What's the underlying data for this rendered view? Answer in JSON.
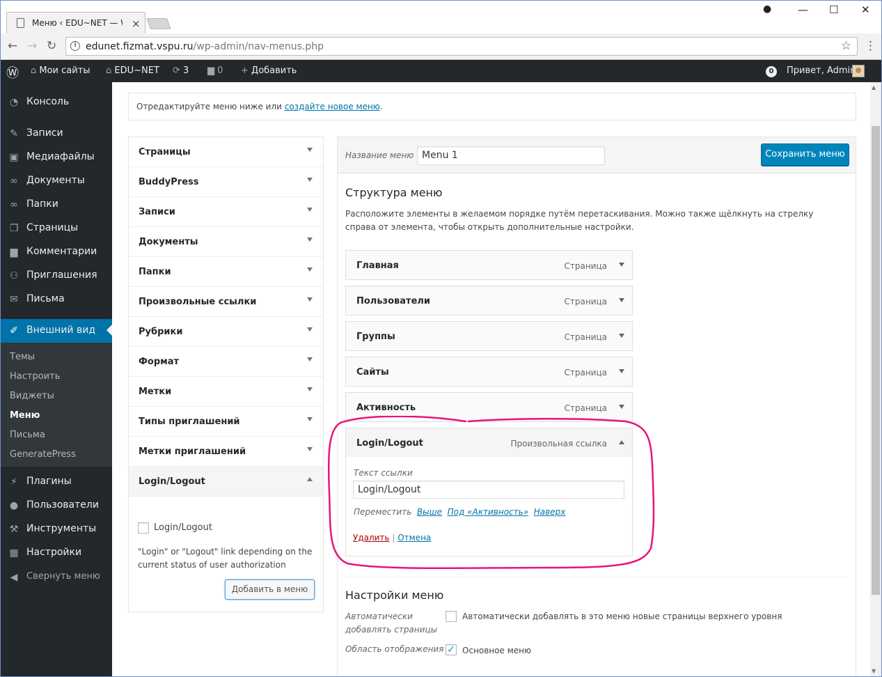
{
  "browser": {
    "tab_title": "Меню ‹ EDU~NET — Wo",
    "url_host": "edunet.fizmat.vspu.ru",
    "url_path": "/wp-admin/nav-menus.php"
  },
  "adminbar": {
    "my_sites": "Мои сайты",
    "site": "EDU~NET",
    "updates": "3",
    "comments": "0",
    "add": "Добавить",
    "notif_count": "0",
    "greeting": "Привет, Admin"
  },
  "sidebar": {
    "items": [
      {
        "label": "Консоль",
        "icon": "dashboard-icon"
      },
      {
        "label": "Записи",
        "icon": "pin-icon"
      },
      {
        "label": "Медиафайлы",
        "icon": "media-icon"
      },
      {
        "label": "Документы",
        "icon": "link-icon"
      },
      {
        "label": "Папки",
        "icon": "link-icon"
      },
      {
        "label": "Страницы",
        "icon": "pages-icon"
      },
      {
        "label": "Комментарии",
        "icon": "comment-icon"
      },
      {
        "label": "Приглашения",
        "icon": "group-icon"
      },
      {
        "label": "Письма",
        "icon": "mail-icon"
      },
      {
        "label": "Внешний вид",
        "icon": "brush-icon"
      }
    ],
    "sub": [
      "Темы",
      "Настроить",
      "Виджеты",
      "Меню",
      "Письма",
      "GeneratePress"
    ],
    "lower": [
      {
        "label": "Плагины",
        "icon": "plugin-icon"
      },
      {
        "label": "Пользователи",
        "icon": "user-icon"
      },
      {
        "label": "Инструменты",
        "icon": "wrench-icon"
      },
      {
        "label": "Настройки",
        "icon": "settings-icon"
      }
    ],
    "collapse": "Свернуть меню"
  },
  "notice": {
    "text": "Отредактируйте меню ниже или ",
    "link": "создайте новое меню",
    "end": "."
  },
  "accordion": {
    "items": [
      "Страницы",
      "BuddyPress",
      "Записи",
      "Документы",
      "Папки",
      "Произвольные ссылки",
      "Рубрики",
      "Формат",
      "Метки",
      "Типы приглашений",
      "Метки приглашений",
      "Login/Logout"
    ],
    "checkbox_label": "Login/Logout",
    "description": "\"Login\" or \"Logout\" link depending on the current status of user authorization",
    "add_button": "Добавить в меню"
  },
  "editor": {
    "name_label": "Название меню",
    "name_value": "Menu 1",
    "save_button": "Сохранить меню",
    "structure_title": "Структура меню",
    "structure_desc": "Расположите элементы в желаемом порядке путём перетаскивания. Можно также щёлкнуть на стрелку справа от элемента, чтобы открыть дополнительные настройки.",
    "items": [
      {
        "label": "Главная",
        "type": "Страница"
      },
      {
        "label": "Пользователи",
        "type": "Страница"
      },
      {
        "label": "Группы",
        "type": "Страница"
      },
      {
        "label": "Сайты",
        "type": "Страница"
      },
      {
        "label": "Активность",
        "type": "Страница"
      },
      {
        "label": "Login/Logout",
        "type": "Произвольная ссылка"
      }
    ],
    "link_text_label": "Текст ссылки",
    "link_text_value": "Login/Logout",
    "move_label": "Переместить",
    "move_up": "Выше",
    "move_under": "Под «Активность»",
    "move_top": "Наверх",
    "delete": "Удалить",
    "sep": "|",
    "cancel": "Отмена",
    "settings_title": "Настройки меню",
    "auto_add_label1": "Автоматически",
    "auto_add_label2": "добавлять страницы",
    "auto_add_text": "Автоматически добавлять в это меню новые страницы верхнего уровня",
    "location_label": "Область отображения",
    "location_text": "Основное меню"
  },
  "colors": {
    "accent": "#0073aa",
    "primary_button": "#0085ba",
    "highlight": "#e8137a",
    "adminbar": "#23282d"
  }
}
